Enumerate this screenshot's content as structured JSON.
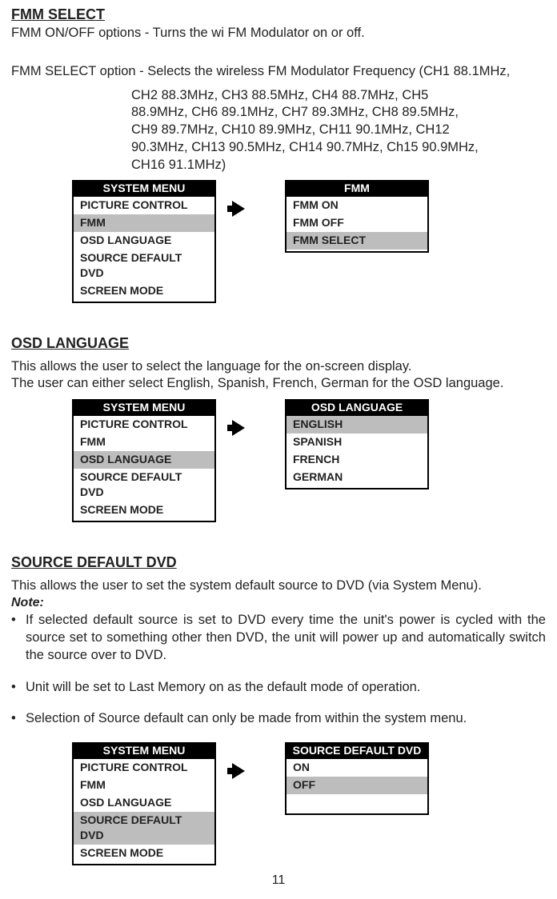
{
  "fmm": {
    "heading": "FMM SELECT",
    "p1": "FMM ON/OFF options - Turns the wi FM Modulator on or off.",
    "p2_lead": "FMM SELECT option - Selects the wireless FM Modulator Frequency (CH1  88.1MHz,",
    "p2_l2": "CH2   88.3MHz,  CH3   88.5MHz,  CH4   88.7MHz,  CH5",
    "p2_l3": "88.9MHz,  CH6   89.1MHz,  CH7   89.3MHz,  CH8   89.5MHz,",
    "p2_l4": "CH9   89.7MHz,  CH10   89.9MHz,  CH11   90.1MHz,  CH12",
    "p2_l5": "90.3MHz, CH13  90.5MHz, CH14  90.7MHz, Ch15  90.9MHz,",
    "p2_l6": "CH16  91.1MHz)",
    "menu_left_title": "SYSTEM MENU",
    "menu_left_items": {
      "i0": "PICTURE CONTROL",
      "i1": "FMM",
      "i2": "OSD LANGUAGE",
      "i3": "SOURCE DEFAULT DVD",
      "i4": "SCREEN MODE"
    },
    "menu_right_title": "FMM",
    "menu_right_items": {
      "i0": "FMM ON",
      "i1": "FMM OFF",
      "i2": "FMM SELECT"
    }
  },
  "osd": {
    "heading": "OSD LANGUAGE",
    "p1": "This allows the user to select the language for the on-screen display.",
    "p2": "The user can either select English, Spanish, French, German for the OSD language.",
    "menu_left_title": "SYSTEM MENU",
    "menu_left_items": {
      "i0": "PICTURE CONTROL",
      "i1": "FMM",
      "i2": "OSD LANGUAGE",
      "i3": "SOURCE DEFAULT DVD",
      "i4": "SCREEN MODE"
    },
    "menu_right_title": "OSD LANGUAGE",
    "menu_right_items": {
      "i0": "ENGLISH",
      "i1": "SPANISH",
      "i2": "FRENCH",
      "i3": "GERMAN"
    }
  },
  "src": {
    "heading": "SOURCE DEFAULT DVD",
    "p1": "This allows the user to set the system default source to DVD (via System Menu).",
    "note": "Note:",
    "b1": "If selected default source is set to DVD every time the unit's power is cycled with the source set to something other then DVD, the unit will power up and automatically switch the source over to DVD.",
    "b2": "Unit will be set to Last Memory on as the default mode of operation.",
    "b3": "Selection of Source default can only be made from within the system menu.",
    "menu_left_title": "SYSTEM MENU",
    "menu_left_items": {
      "i0": "PICTURE CONTROL",
      "i1": "FMM",
      "i2": "OSD LANGUAGE",
      "i3": "SOURCE DEFAULT DVD",
      "i4": "SCREEN MODE"
    },
    "menu_right_title": "SOURCE DEFAULT DVD",
    "menu_right_items": {
      "i0": "ON",
      "i1": "OFF"
    }
  },
  "page_number": "11"
}
